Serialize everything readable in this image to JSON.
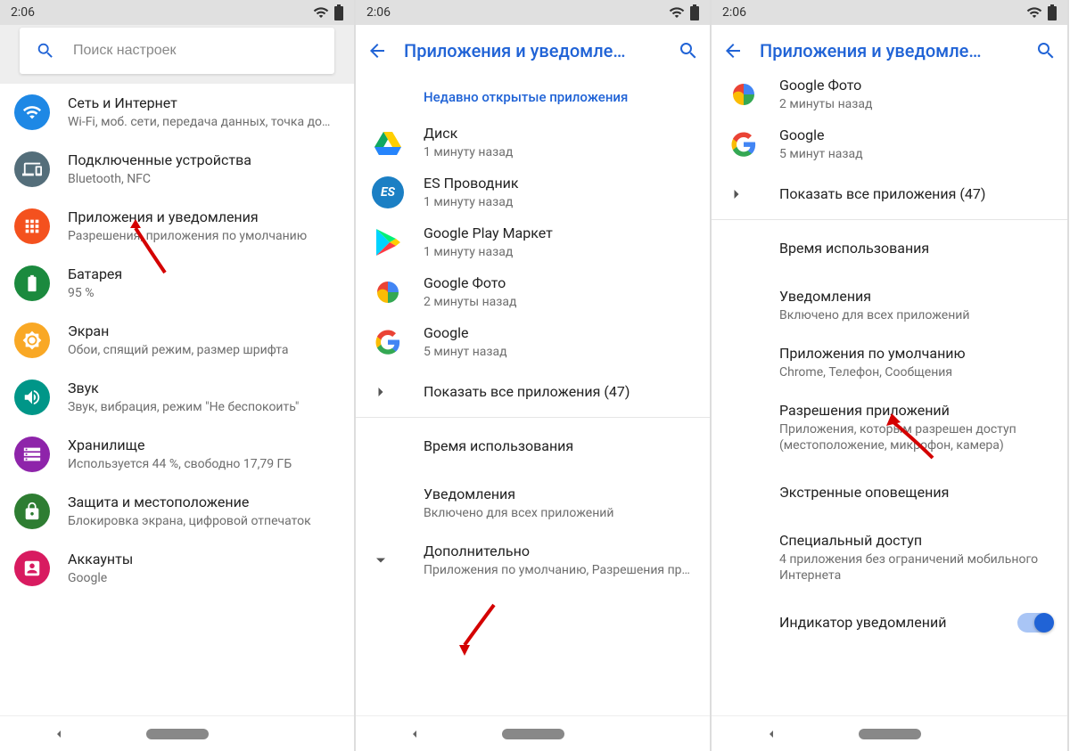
{
  "statusbar": {
    "time": "2:06"
  },
  "p1": {
    "search_placeholder": "Поиск настроек",
    "items": [
      {
        "title": "Сеть и Интернет",
        "sub": "Wi-Fi, моб. сети, передача данных, точка до…",
        "color": "#1e88e5",
        "icon": "wifi"
      },
      {
        "title": "Подключенные устройства",
        "sub": "Bluetooth, NFC",
        "color": "#546e7a",
        "icon": "devices"
      },
      {
        "title": "Приложения и уведомления",
        "sub": "Разрешения, приложения по умолчанию",
        "color": "#f4511e",
        "icon": "apps"
      },
      {
        "title": "Батарея",
        "sub": "95 %",
        "color": "#1b8a3e",
        "icon": "battery"
      },
      {
        "title": "Экран",
        "sub": "Обои, спящий режим, размер шрифта",
        "color": "#f9a825",
        "icon": "brightness"
      },
      {
        "title": "Звук",
        "sub": "Звук, вибрация, режим \"Не беспокоить\"",
        "color": "#009688",
        "icon": "sound"
      },
      {
        "title": "Хранилище",
        "sub": "Используется 44 %, свободно 17,79 ГБ",
        "color": "#8e24aa",
        "icon": "storage"
      },
      {
        "title": "Защита и местоположение",
        "sub": "Блокировка экрана, цифровой отпечаток",
        "color": "#2e7d32",
        "icon": "security"
      },
      {
        "title": "Аккаунты",
        "sub": "Google",
        "color": "#d81b60",
        "icon": "account"
      }
    ]
  },
  "p2": {
    "header": "Приложения и уведомле…",
    "recent_label": "Недавно открытые приложения",
    "apps": [
      {
        "title": "Диск",
        "sub": "1 минуту назад",
        "icon": "drive"
      },
      {
        "title": "ES Проводник",
        "sub": "1 минуту назад",
        "icon": "es"
      },
      {
        "title": "Google Play Маркет",
        "sub": "1 минуту назад",
        "icon": "play"
      },
      {
        "title": "Google Фото",
        "sub": "2 минуты назад",
        "icon": "photos"
      },
      {
        "title": "Google",
        "sub": "5 минут назад",
        "icon": "google"
      }
    ],
    "show_all": "Показать все приложения (47)",
    "rows": [
      {
        "title": "Время использования",
        "sub": ""
      },
      {
        "title": "Уведомления",
        "sub": "Включено для всех приложений"
      },
      {
        "title": "Дополнительно",
        "sub": "Приложения по умолчанию, Разрешения пр…",
        "expand": true
      }
    ]
  },
  "p3": {
    "header": "Приложения и уведомле…",
    "apps": [
      {
        "title": "Google Фото",
        "sub": "2 минуты назад",
        "icon": "photos"
      },
      {
        "title": "Google",
        "sub": "5 минут назад",
        "icon": "google"
      }
    ],
    "show_all": "Показать все приложения (47)",
    "rows": [
      {
        "title": "Время использования",
        "sub": ""
      },
      {
        "title": "Уведомления",
        "sub": "Включено для всех приложений"
      },
      {
        "title": "Приложения по умолчанию",
        "sub": "Chrome, Телефон, Сообщения"
      },
      {
        "title": "Разрешения приложений",
        "sub": "Приложения, которым разрешен доступ (местоположение, микрофон, камера)"
      },
      {
        "title": "Экстренные оповещения",
        "sub": ""
      },
      {
        "title": "Специальный доступ",
        "sub": "4 приложения без ограничений мобильного Интернета"
      }
    ],
    "toggle_label": "Индикатор уведомлений"
  }
}
